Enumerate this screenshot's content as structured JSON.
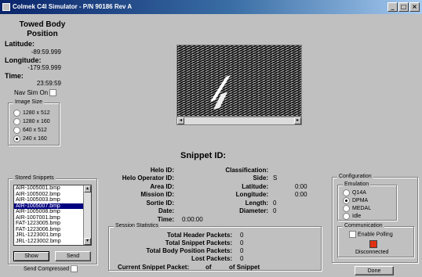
{
  "window": {
    "title": "Colmek C4I Simulator - P/N 90186 Rev A"
  },
  "towed": {
    "title": "Towed Body Position",
    "lat_label": "Latitude:",
    "lat_value": "-89:59.999",
    "lon_label": "Longitude:",
    "lon_value": "-179:59.999",
    "time_label": "Time:",
    "time_value": "23:59:59",
    "navsim_label": "Nav Sim On"
  },
  "image_size": {
    "caption": "Image Size",
    "options": [
      "1280 x 512",
      "1280 x 160",
      "640 x 512",
      "240 x 160"
    ],
    "selected": "240 x 160"
  },
  "snippet": {
    "title": "Snippet ID:",
    "helo_id": "Helo ID:",
    "helo_op_id": "Helo Operator ID:",
    "area_id": "Area ID:",
    "mission_id": "Mission ID:",
    "sortie_id": "Sortie ID:",
    "date": "Date:",
    "time": "Time:",
    "time_value": "0:00:00",
    "classification": "Classification:",
    "side": "Side:",
    "side_value": "S",
    "latitude": "Latitude:",
    "latitude_value": "0:00",
    "longitude": "Longitude:",
    "longitude_value": "0:00",
    "length": "Length:",
    "length_value": "0",
    "diameter": "Diameter:",
    "diameter_value": "0"
  },
  "stored": {
    "caption": "Stored Snippets",
    "items": [
      "AIR-1005001.bmp",
      "AIR-1005002.bmp",
      "AIR-1005003.bmp",
      "AIR-1005007.bmp",
      "AIR-1005008.bmp",
      "AIR-1007001.bmp",
      "FAT-1223005.bmp",
      "FAT-1223006.bmp",
      "JRL-1223001.bmp",
      "JRL-1223002.bmp"
    ],
    "selected": "AIR-1005007.bmp",
    "show": "Show",
    "send": "Send",
    "compressed": "Send Compressed"
  },
  "stats": {
    "caption": "Session Statistics",
    "header_label": "Total Header Packets:",
    "header_value": "0",
    "snippet_label": "Total Snippet Packets:",
    "snippet_value": "0",
    "body_label": "Total Body Position Packets:",
    "body_value": "0",
    "lost_label": "Lost Packets:",
    "lost_value": "0",
    "current_label": "Current Snippet Packet:",
    "of1": "of",
    "of2": "of Snippet"
  },
  "config": {
    "caption": "Configuration",
    "emulation": "Emulation",
    "options": [
      "Q14A",
      "DPMA",
      "MEDAL",
      "Idle"
    ],
    "selected": "DPMA",
    "comm": "Communication",
    "polling": "Enable Polling",
    "status": "Disconnected",
    "status_color": "#e03010",
    "done": "Done"
  }
}
